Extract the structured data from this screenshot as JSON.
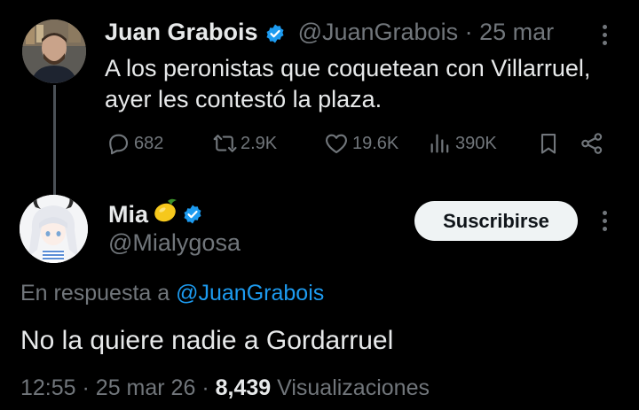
{
  "original_tweet": {
    "author_name": "Juan Grabois",
    "author_handle": "@JuanGrabois",
    "separator": "·",
    "date": "25 mar",
    "text": "A los peronistas que coquetean con Villarruel, ayer les contestó la plaza.",
    "stats": {
      "replies": "682",
      "retweets": "2.9K",
      "likes": "19.6K",
      "views": "390K"
    }
  },
  "reply_tweet": {
    "author_name": "Mia",
    "author_emoji": "🍋",
    "author_handle": "@Mialygosa",
    "subscribe_label": "Suscribirse",
    "in_reply_prefix": "En respuesta a",
    "in_reply_handle": "@JuanGrabois",
    "text": "No la quiere nadie a Gordarruel",
    "time": "12:55",
    "separator": "·",
    "date": "25 mar 26",
    "separator2": "·",
    "views_count": "8,439",
    "views_label": "Visualizaciones"
  },
  "colors": {
    "background": "#000000",
    "text": "#e7e9ea",
    "muted": "#71767b",
    "accent": "#1d9bf0",
    "button_bg": "#eff3f4"
  },
  "icons": [
    "verified-badge-icon",
    "more-icon",
    "reply-icon",
    "retweet-icon",
    "like-icon",
    "views-icon",
    "bookmark-icon",
    "share-icon",
    "lemon-emoji"
  ]
}
